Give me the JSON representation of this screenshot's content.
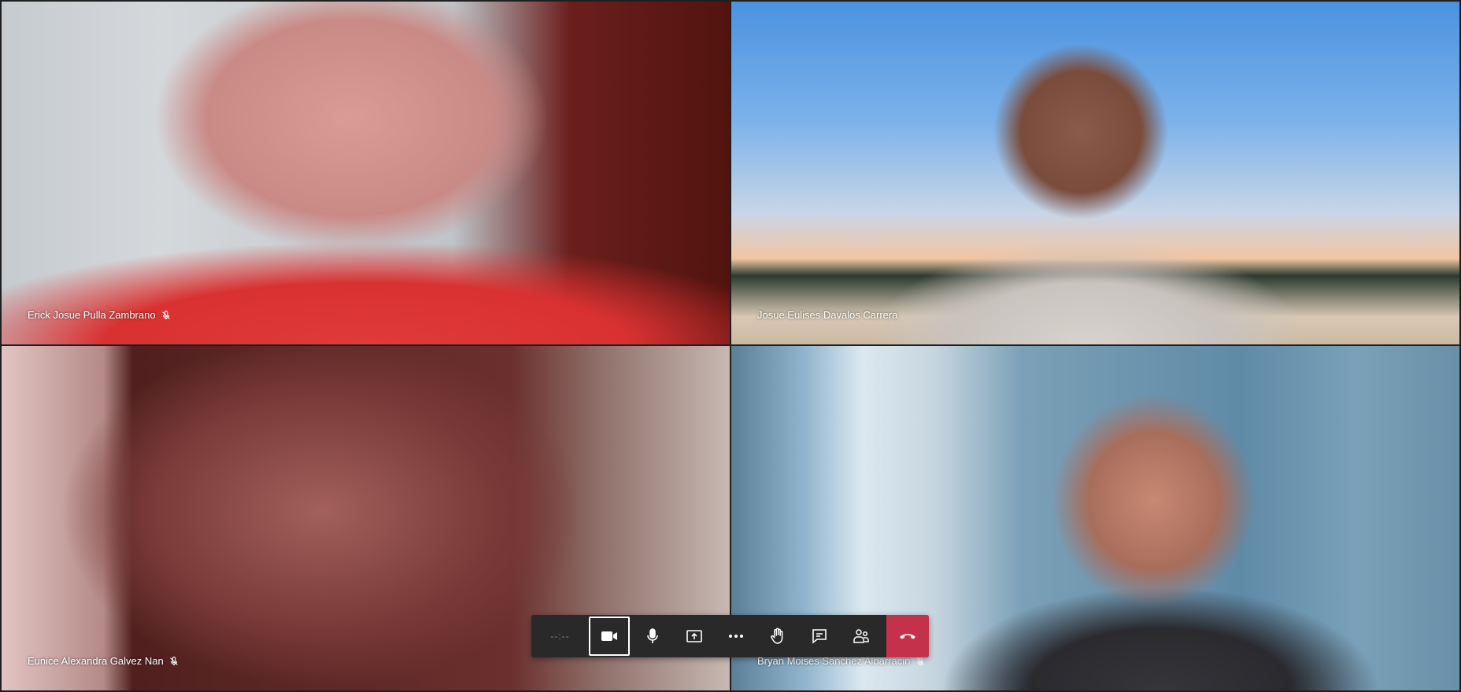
{
  "participants": [
    {
      "name": "Erick Josue Pulla Zambrano",
      "muted": true
    },
    {
      "name": "Josue Eulises Davalos Carrera",
      "muted": false
    },
    {
      "name": "Eunice Alexandra Galvez Nan",
      "muted": true
    },
    {
      "name": "Bryan Moises Sanchez Albarracin",
      "muted": true
    }
  ],
  "toolbar": {
    "timer": "--:--",
    "buttons": [
      {
        "icon": "camera-icon",
        "state": "on"
      },
      {
        "icon": "microphone-icon"
      },
      {
        "icon": "share-screen-icon"
      },
      {
        "icon": "more-options-icon"
      },
      {
        "icon": "raise-hand-icon"
      },
      {
        "icon": "chat-icon"
      },
      {
        "icon": "participants-icon"
      },
      {
        "icon": "hang-up-icon"
      }
    ],
    "hangup_color": "#c4314b"
  }
}
